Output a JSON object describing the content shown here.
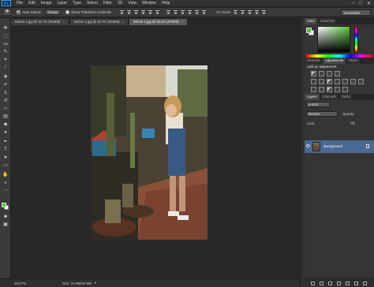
{
  "app": {
    "logo": "Ps"
  },
  "menu": [
    "File",
    "Edit",
    "Image",
    "Layer",
    "Type",
    "Select",
    "Filter",
    "3D",
    "View",
    "Window",
    "Help"
  ],
  "window_controls": {
    "minimize": "–",
    "maximize": "□",
    "close": "✕"
  },
  "options_bar": {
    "auto_select_label": "Auto-Select:",
    "auto_select_value": "Group",
    "transform_controls_label": "Show Transform Controls",
    "three_d_mode": "3D Mode:",
    "workspace": "Essentials"
  },
  "tabs": [
    {
      "label": "Before 1.jpg @ 16.7% (RGB/8)"
    },
    {
      "label": "Before 1.jpg @ 16.7% (RGB/8)"
    },
    {
      "label": "Before 1.jpg @ 33.3% (RGB/8)"
    }
  ],
  "tab_close": "×",
  "status": {
    "zoom": "16.67%",
    "doc": "Doc: 24.9M/24.9M",
    "arrow": "▸"
  },
  "panels": {
    "color_tabs": [
      "Color",
      "Swatches"
    ],
    "adjust_tabs": [
      "Libraries",
      "Adjustments",
      "Styles"
    ],
    "adjust_title": "Add an adjustment",
    "layers_tabs": [
      "Layers",
      "Channels",
      "Paths"
    ],
    "kind": "ρ Kind",
    "blend_mode": "Normal",
    "opacity_label": "Opacity:",
    "lock_label": "Lock:",
    "fill_label": "Fill:",
    "layer_name": "Background"
  },
  "colors": {
    "foreground": "#58c43a",
    "background": "#ffffff",
    "selected_layer": "#4a6a94"
  },
  "icons": {
    "tools": [
      "move-icon",
      "marquee-icon",
      "lasso-icon",
      "quick-select-icon",
      "crop-icon",
      "eyedropper-icon",
      "healing-brush-icon",
      "brush-icon",
      "clone-stamp-icon",
      "history-brush-icon",
      "eraser-icon",
      "gradient-icon",
      "blur-icon",
      "dodge-icon",
      "pen-icon",
      "type-icon",
      "path-select-icon",
      "rectangle-icon",
      "hand-icon",
      "zoom-icon"
    ]
  }
}
